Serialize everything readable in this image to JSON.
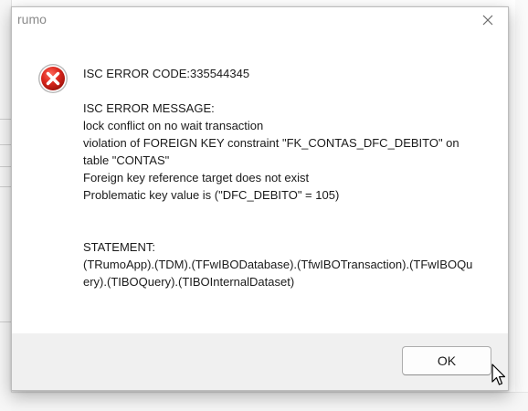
{
  "window": {
    "title": "rumo",
    "close_icon": "close-icon",
    "error_icon": "error-icon",
    "error_icon_color": "#d32f2f"
  },
  "message": {
    "text": "ISC ERROR CODE:335544345\n\nISC ERROR MESSAGE:\nlock conflict on no wait transaction\nviolation of FOREIGN KEY constraint \"FK_CONTAS_DFC_DEBITO\" on\ntable \"CONTAS\"\nForeign key reference target does not exist\nProblematic key value is (\"DFC_DEBITO\" = 105)\n\n\nSTATEMENT:\n(TRumoApp).(TDM).(TFwIBODatabase).(TfwIBOTransaction).(TFwIBOQu\nery).(TIBOQuery).(TIBOInternalDataset)"
  },
  "buttons": {
    "ok_label": "OK"
  }
}
